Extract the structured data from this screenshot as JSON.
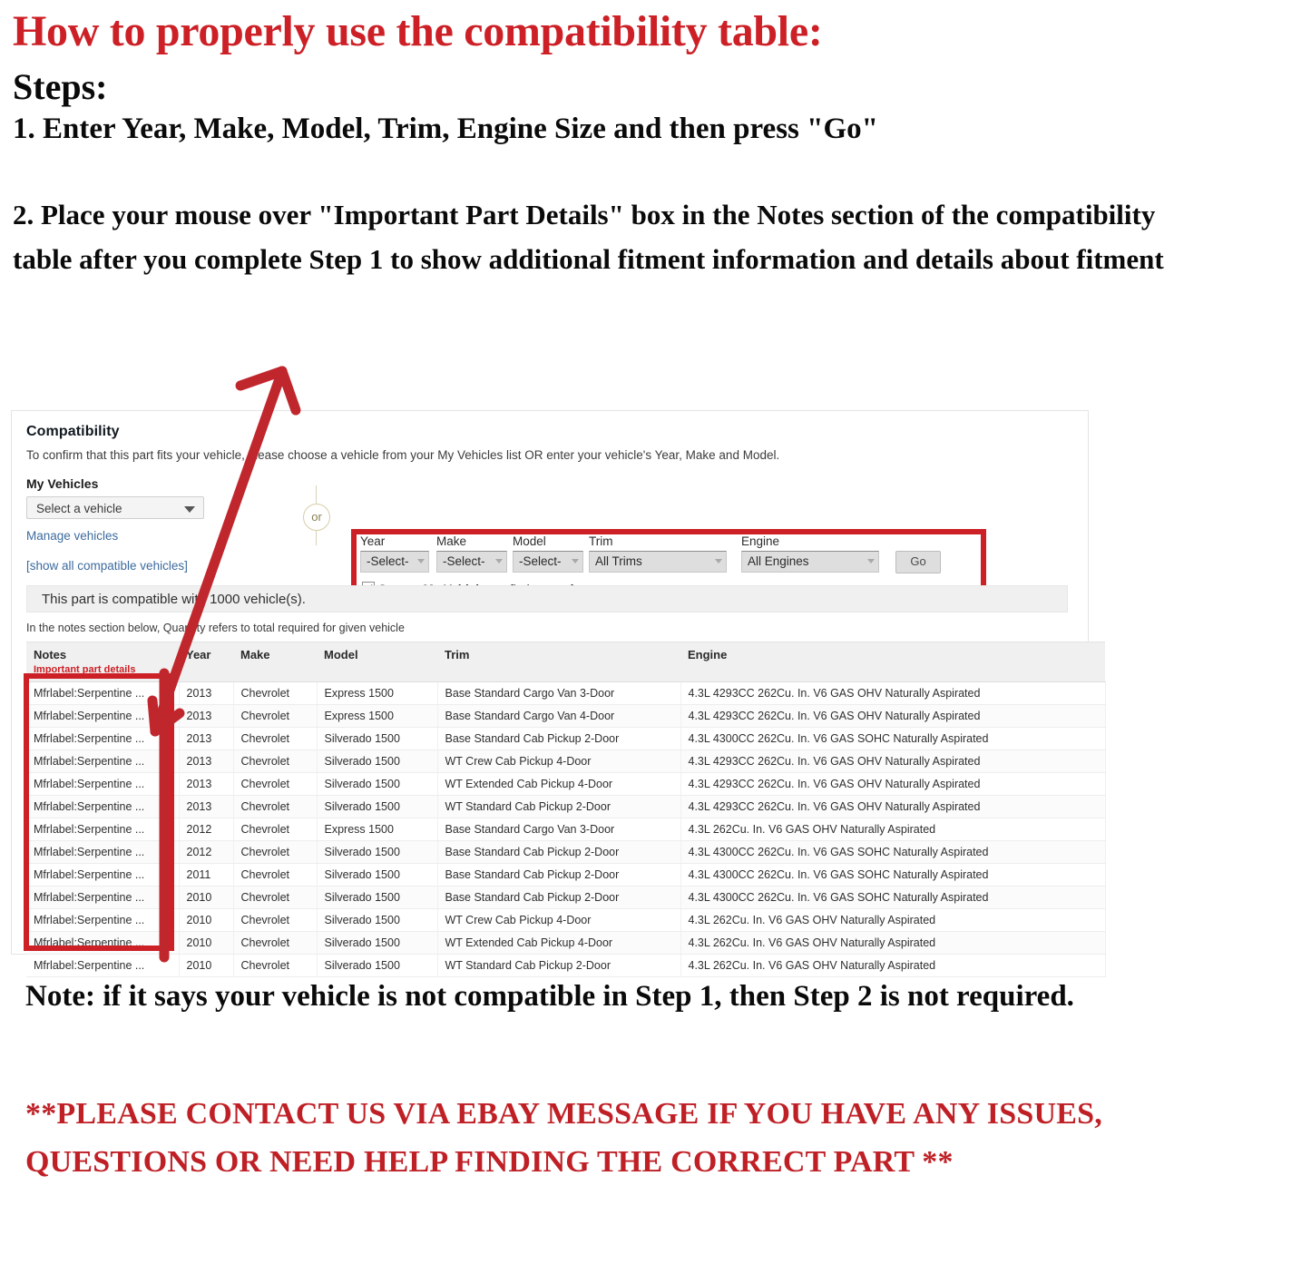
{
  "instructions": {
    "headline": "How to properly use the compatibility table:",
    "steps_label": "Steps:",
    "step1": "1. Enter Year, Make, Model, Trim, Engine Size and then press \"Go\"",
    "step2": "2. Place your mouse over \"Important Part Details\" box in the Notes section of the compatibility table after you complete Step 1 to show additional fitment information and details about fitment"
  },
  "panel": {
    "title": "Compatibility",
    "subtitle": "To confirm that this part fits your vehicle, please choose a vehicle from your My Vehicles list OR enter your vehicle's Year, Make and Model.",
    "my_vehicles": {
      "label": "My Vehicles",
      "select_value": "Select a vehicle",
      "manage_link": "Manage vehicles",
      "show_all_link": "[show all compatible vehicles]"
    },
    "or_label": "or",
    "ymm_form": {
      "year_label": "Year",
      "year_value": "-Select-",
      "make_label": "Make",
      "make_value": "-Select-",
      "model_label": "Model",
      "model_value": "-Select-",
      "trim_label": "Trim",
      "trim_value": "All Trims",
      "engine_label": "Engine",
      "engine_value": "All Engines",
      "go_button": "Go",
      "save_prefix": "Save to ",
      "save_bold": "My Vehicles",
      "save_suffix": " to finds parts faster"
    },
    "compat_banner": "This part is compatible with 1000 vehicle(s).",
    "notes_hint": "In the notes section below, Quantity refers to total required for given vehicle"
  },
  "table": {
    "headers": {
      "notes": "Notes",
      "notes_sub": "Important part details",
      "year": "Year",
      "make": "Make",
      "model": "Model",
      "trim": "Trim",
      "engine": "Engine"
    },
    "rows": [
      {
        "notes": "Mfrlabel:Serpentine ...",
        "year": "2013",
        "make": "Chevrolet",
        "model": "Express 1500",
        "trim": "Base Standard Cargo Van 3-Door",
        "engine": "4.3L 4293CC 262Cu. In. V6 GAS OHV Naturally Aspirated"
      },
      {
        "notes": "Mfrlabel:Serpentine ...",
        "year": "2013",
        "make": "Chevrolet",
        "model": "Express 1500",
        "trim": "Base Standard Cargo Van 4-Door",
        "engine": "4.3L 4293CC 262Cu. In. V6 GAS OHV Naturally Aspirated"
      },
      {
        "notes": "Mfrlabel:Serpentine ...",
        "year": "2013",
        "make": "Chevrolet",
        "model": "Silverado 1500",
        "trim": "Base Standard Cab Pickup 2-Door",
        "engine": "4.3L 4300CC 262Cu. In. V6 GAS SOHC Naturally Aspirated"
      },
      {
        "notes": "Mfrlabel:Serpentine ...",
        "year": "2013",
        "make": "Chevrolet",
        "model": "Silverado 1500",
        "trim": "WT Crew Cab Pickup 4-Door",
        "engine": "4.3L 4293CC 262Cu. In. V6 GAS OHV Naturally Aspirated"
      },
      {
        "notes": "Mfrlabel:Serpentine ...",
        "year": "2013",
        "make": "Chevrolet",
        "model": "Silverado 1500",
        "trim": "WT Extended Cab Pickup 4-Door",
        "engine": "4.3L 4293CC 262Cu. In. V6 GAS OHV Naturally Aspirated"
      },
      {
        "notes": "Mfrlabel:Serpentine ...",
        "year": "2013",
        "make": "Chevrolet",
        "model": "Silverado 1500",
        "trim": "WT Standard Cab Pickup 2-Door",
        "engine": "4.3L 4293CC 262Cu. In. V6 GAS OHV Naturally Aspirated"
      },
      {
        "notes": "Mfrlabel:Serpentine ...",
        "year": "2012",
        "make": "Chevrolet",
        "model": "Express 1500",
        "trim": "Base Standard Cargo Van 3-Door",
        "engine": "4.3L 262Cu. In. V6 GAS OHV Naturally Aspirated"
      },
      {
        "notes": "Mfrlabel:Serpentine ...",
        "year": "2012",
        "make": "Chevrolet",
        "model": "Silverado 1500",
        "trim": "Base Standard Cab Pickup 2-Door",
        "engine": "4.3L 4300CC 262Cu. In. V6 GAS SOHC Naturally Aspirated"
      },
      {
        "notes": "Mfrlabel:Serpentine ...",
        "year": "2011",
        "make": "Chevrolet",
        "model": "Silverado 1500",
        "trim": "Base Standard Cab Pickup 2-Door",
        "engine": "4.3L 4300CC 262Cu. In. V6 GAS SOHC Naturally Aspirated"
      },
      {
        "notes": "Mfrlabel:Serpentine ...",
        "year": "2010",
        "make": "Chevrolet",
        "model": "Silverado 1500",
        "trim": "Base Standard Cab Pickup 2-Door",
        "engine": "4.3L 4300CC 262Cu. In. V6 GAS SOHC Naturally Aspirated"
      },
      {
        "notes": "Mfrlabel:Serpentine ...",
        "year": "2010",
        "make": "Chevrolet",
        "model": "Silverado 1500",
        "trim": "WT Crew Cab Pickup 4-Door",
        "engine": "4.3L 262Cu. In. V6 GAS OHV Naturally Aspirated"
      },
      {
        "notes": "Mfrlabel:Serpentine ...",
        "year": "2010",
        "make": "Chevrolet",
        "model": "Silverado 1500",
        "trim": "WT Extended Cab Pickup 4-Door",
        "engine": "4.3L 262Cu. In. V6 GAS OHV Naturally Aspirated"
      },
      {
        "notes": "Mfrlabel:Serpentine ...",
        "year": "2010",
        "make": "Chevrolet",
        "model": "Silverado 1500",
        "trim": "WT Standard Cab Pickup 2-Door",
        "engine": "4.3L 262Cu. In. V6 GAS OHV Naturally Aspirated"
      }
    ]
  },
  "footer": {
    "note": "Note: if it says your vehicle is not compatible in Step 1, then Step 2 is not required.",
    "contact": "**PLEASE CONTACT US VIA EBAY MESSAGE IF YOU HAVE ANY ISSUES, QUESTIONS OR NEED HELP FINDING THE CORRECT PART **"
  },
  "colors": {
    "red": "#cc2026",
    "link": "#3d6b9e",
    "text": "#2f2f2f"
  }
}
